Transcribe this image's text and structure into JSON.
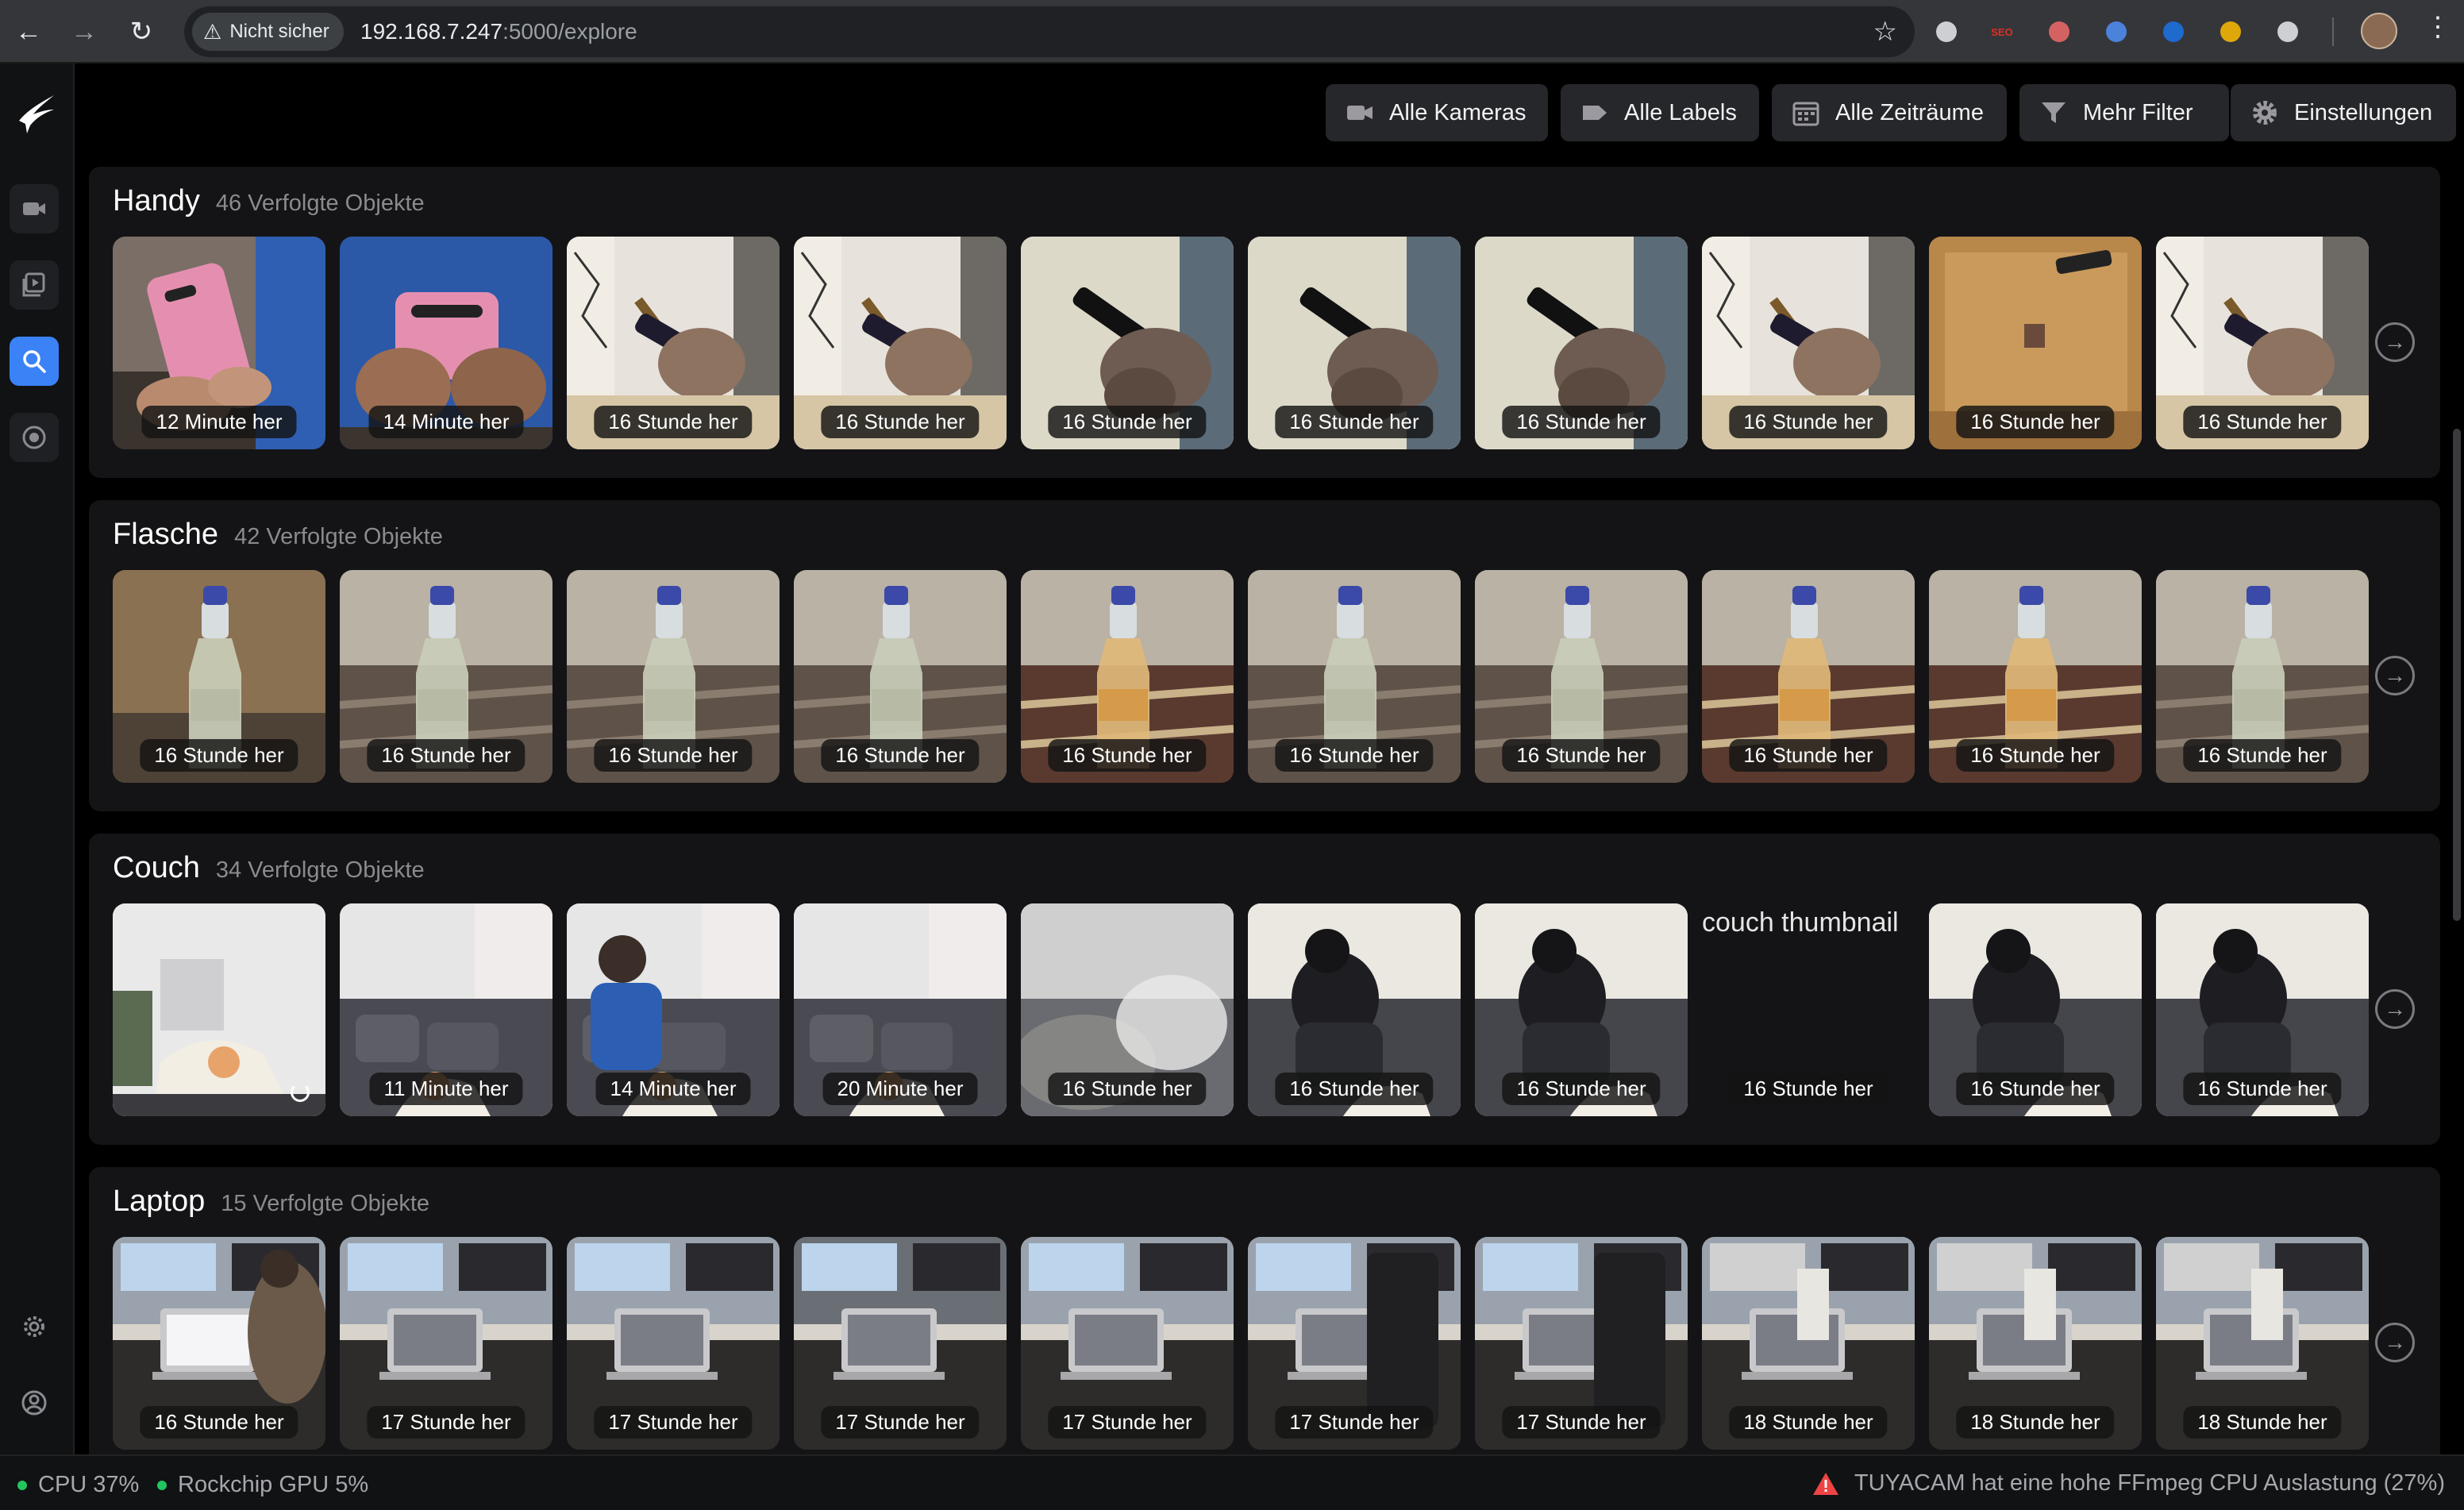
{
  "browser": {
    "security_label": "Nicht sicher",
    "url_host": "192.168.7.247",
    "url_rest": ":5000/explore",
    "extensions": [
      {
        "icon": "globe-extension-icon",
        "text": "",
        "color": "#e8eaed"
      },
      {
        "icon": "seo-extension-icon",
        "text": "SEO",
        "color": "#d93025"
      },
      {
        "icon": "asana-extension-icon",
        "text": "",
        "color": "#f06a6a"
      },
      {
        "icon": "puzzle-blue-extension-icon",
        "text": "",
        "color": "#4f8ff7"
      },
      {
        "icon": "download-extension-icon",
        "text": "",
        "color": "#1a73e8"
      },
      {
        "icon": "color-wheel-extension-icon",
        "text": "",
        "color": "#fbbc04"
      },
      {
        "icon": "extensions-icon",
        "text": "",
        "color": "#e8eaed"
      }
    ]
  },
  "filters": {
    "cameras": "Alle Kameras",
    "labels": "Alle Labels",
    "timeframes": "Alle Zeiträume",
    "more": "Mehr Filter",
    "settings": "Einstellungen"
  },
  "sections": [
    {
      "key": "handy",
      "title": "Handy",
      "count": "46 Verfolgte Objekte",
      "thumbs": [
        {
          "time": "12 Minute her",
          "scene": "pink-phone"
        },
        {
          "time": "14 Minute her",
          "scene": "pink-phone-blue"
        },
        {
          "time": "16 Stunde her",
          "scene": "phone-window"
        },
        {
          "time": "16 Stunde her",
          "scene": "phone-window"
        },
        {
          "time": "16 Stunde her",
          "scene": "phone-wall"
        },
        {
          "time": "16 Stunde her",
          "scene": "phone-wall"
        },
        {
          "time": "16 Stunde her",
          "scene": "phone-wall"
        },
        {
          "time": "16 Stunde her",
          "scene": "phone-window"
        },
        {
          "time": "16 Stunde her",
          "scene": "phone-table"
        },
        {
          "time": "16 Stunde her",
          "scene": "phone-window"
        }
      ]
    },
    {
      "key": "flasche",
      "title": "Flasche",
      "count": "42 Verfolgte Objekte",
      "thumbs": [
        {
          "time": "16 Stunde her",
          "scene": "bottle-close"
        },
        {
          "time": "16 Stunde her",
          "scene": "bottle"
        },
        {
          "time": "16 Stunde her",
          "scene": "bottle"
        },
        {
          "time": "16 Stunde her",
          "scene": "bottle"
        },
        {
          "time": "16 Stunde her",
          "scene": "bottle-rug"
        },
        {
          "time": "16 Stunde her",
          "scene": "bottle"
        },
        {
          "time": "16 Stunde her",
          "scene": "bottle"
        },
        {
          "time": "16 Stunde her",
          "scene": "bottle-rug"
        },
        {
          "time": "16 Stunde her",
          "scene": "bottle-rug"
        },
        {
          "time": "16 Stunde her",
          "scene": "bottle"
        }
      ]
    },
    {
      "key": "couch",
      "title": "Couch",
      "count": "34 Verfolgte Objekte",
      "thumbs": [
        {
          "time": "",
          "scene": "couch-room",
          "loading": true
        },
        {
          "time": "11 Minute her",
          "scene": "couch"
        },
        {
          "time": "14 Minute her",
          "scene": "couch-person"
        },
        {
          "time": "20 Minute her",
          "scene": "couch"
        },
        {
          "time": "16 Stunde her",
          "scene": "couch-blur"
        },
        {
          "time": "16 Stunde her",
          "scene": "couch-dark"
        },
        {
          "time": "16 Stunde her",
          "scene": "couch-dark"
        },
        {
          "time": "16 Stunde her",
          "scene": "broken",
          "alt": "couch thumbnail"
        },
        {
          "time": "16 Stunde her",
          "scene": "couch-dark"
        },
        {
          "time": "16 Stunde her",
          "scene": "couch-dark"
        }
      ]
    },
    {
      "key": "laptop",
      "title": "Laptop",
      "count": "15 Verfolgte Objekte",
      "thumbs": [
        {
          "time": "16 Stunde her",
          "scene": "laptop-person"
        },
        {
          "time": "17 Stunde her",
          "scene": "laptop-desk"
        },
        {
          "time": "17 Stunde her",
          "scene": "laptop-desk"
        },
        {
          "time": "17 Stunde her",
          "scene": "laptop-desk-dark"
        },
        {
          "time": "17 Stunde her",
          "scene": "laptop-desk"
        },
        {
          "time": "17 Stunde her",
          "scene": "laptop-chair"
        },
        {
          "time": "17 Stunde her",
          "scene": "laptop-chair"
        },
        {
          "time": "18 Stunde her",
          "scene": "laptop-grey"
        },
        {
          "time": "18 Stunde her",
          "scene": "laptop-grey"
        },
        {
          "time": "18 Stunde her",
          "scene": "laptop-grey"
        }
      ]
    }
  ],
  "footer": {
    "cpu": "CPU 37%",
    "gpu": "Rockchip GPU 5%",
    "alert": "TUYACAM hat eine hohe FFmpeg CPU Auslastung (27%)",
    "status_color": "#22c55e",
    "alert_color": "#ef4444"
  }
}
